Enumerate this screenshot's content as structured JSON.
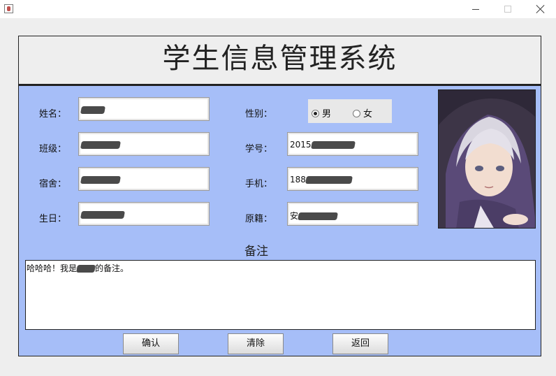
{
  "window": {
    "minimize": "—",
    "maximize": "☐",
    "close": "✕"
  },
  "app_title": "学生信息管理系统",
  "form": {
    "name_label": "姓名：",
    "name_value": "",
    "gender_label": "性别：",
    "gender_options": [
      "男",
      "女"
    ],
    "gender_selected": "男",
    "class_label": "班级：",
    "class_value": "",
    "student_id_label": "学号：",
    "student_id_value": "2015",
    "dorm_label": "宿舍：",
    "dorm_value": "",
    "phone_label": "手机：",
    "phone_value": "188",
    "birthday_label": "生日：",
    "birthday_value": "",
    "origin_label": "原籍：",
    "origin_value": "安"
  },
  "notes": {
    "title": "备注",
    "text_prefix": "哈哈哈！我是",
    "text_suffix": "的备注。"
  },
  "buttons": {
    "confirm": "确认",
    "clear": "清除",
    "back": "返回"
  }
}
